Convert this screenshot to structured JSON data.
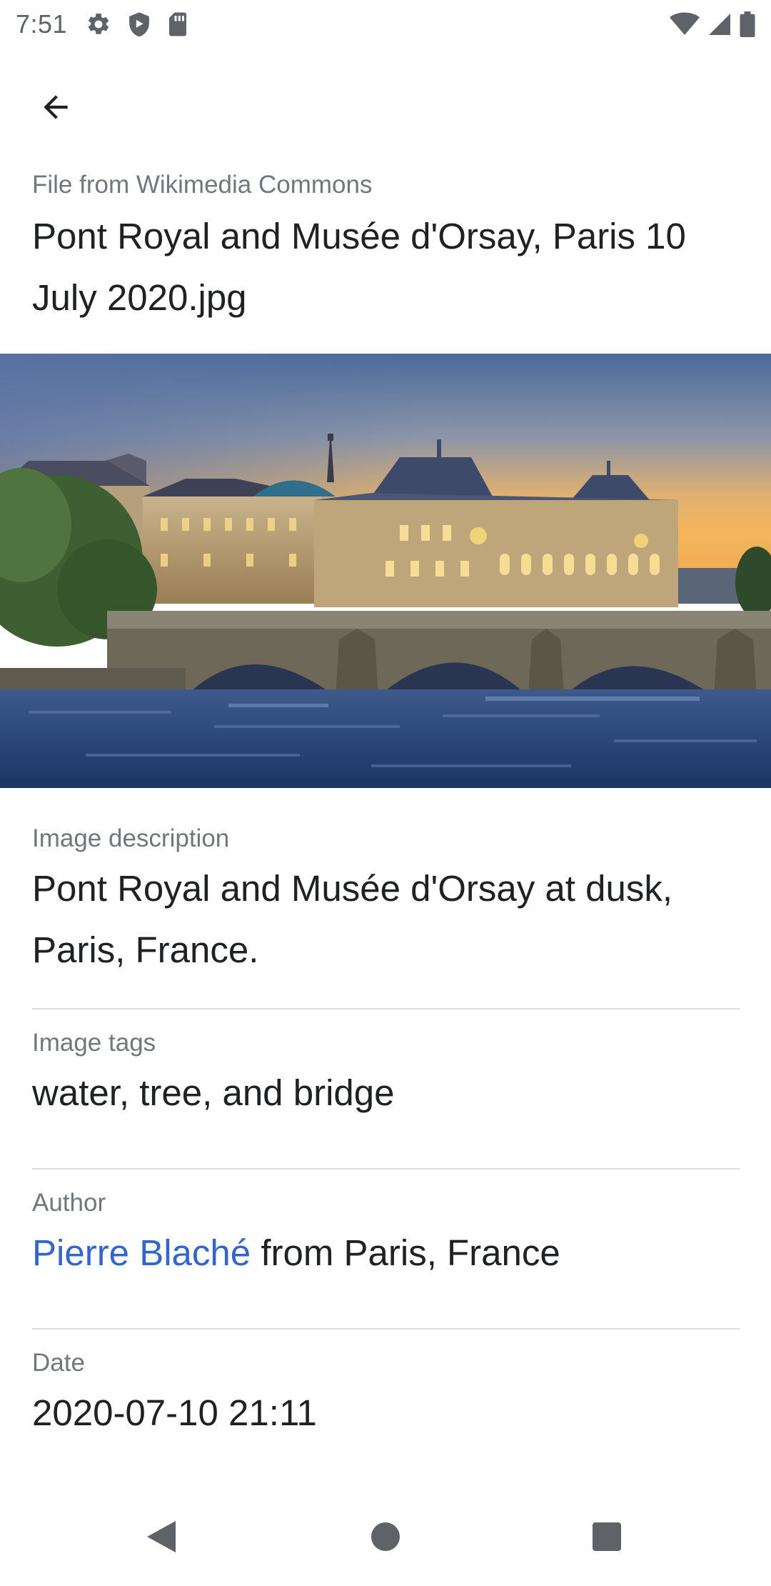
{
  "status_bar": {
    "time": "7:51",
    "left_icons": [
      "settings-icon",
      "shield-icon",
      "sd-card-icon"
    ],
    "right_icons": [
      "wifi-icon",
      "cell-signal-icon",
      "battery-icon"
    ]
  },
  "toolbar": {
    "back_icon": "arrow-back-icon"
  },
  "header": {
    "source_label": "File from Wikimedia Commons",
    "file_title": "Pont Royal and Musée d'Orsay, Paris 10 July 2020.jpg"
  },
  "image": {
    "subject": "photo"
  },
  "sections": {
    "description": {
      "label": "Image description",
      "value": "Pont Royal and Musée d'Orsay at dusk, Paris, France."
    },
    "tags": {
      "label": "Image tags",
      "value": "water, tree, and bridge"
    },
    "author": {
      "label": "Author",
      "link_text": "Pierre Blaché",
      "rest_text": " from Paris, France"
    },
    "date": {
      "label": "Date",
      "value": "2020-07-10 21:11"
    }
  },
  "nav_bar": {
    "buttons": [
      "back-triangle-icon",
      "home-circle-icon",
      "recents-square-icon"
    ]
  },
  "colors": {
    "link": "#3366cc",
    "label": "#72777d",
    "text": "#202122",
    "divider": "#dadde1"
  }
}
